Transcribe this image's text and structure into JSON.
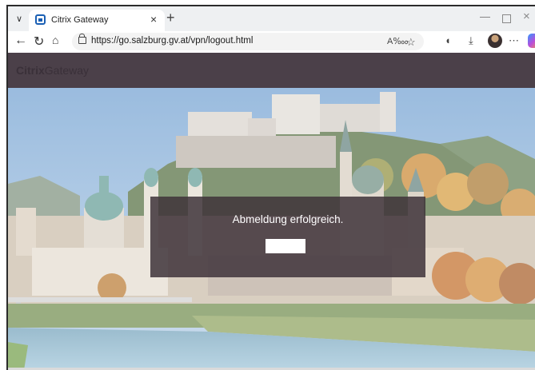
{
  "browser": {
    "tab_title": "Citrix Gateway",
    "url": "https://go.salzburg.gv.at/vpn/logout.html",
    "icons": [
      "chevron-down-icon",
      "favicon-icon",
      "close-icon",
      "plus-icon",
      "minimize-icon",
      "maximize-icon",
      "back-icon",
      "refresh-icon",
      "home-icon",
      "lock-icon",
      "read-aloud-icon",
      "favorite-star-icon",
      "copilot-icon",
      "downloads-icon",
      "profile-avatar",
      "more-icon"
    ]
  },
  "gateway": {
    "brand_bold": "Citrix",
    "brand_light": "Gateway",
    "header_color": "#4b4049"
  },
  "dialog": {
    "message": "Abmeldung erfolgreich.",
    "button_label": ""
  }
}
